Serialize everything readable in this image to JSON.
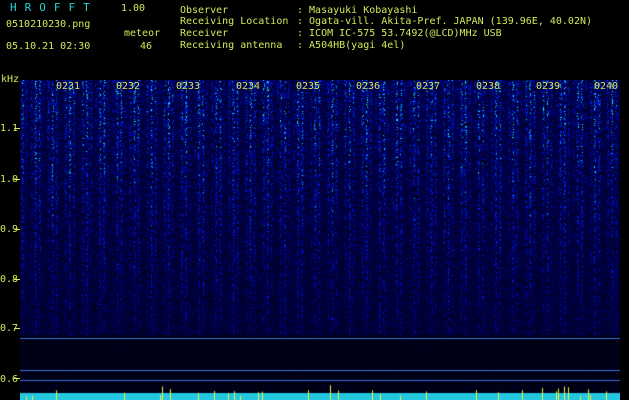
{
  "header": {
    "app_name": "HROFFT",
    "version": "1.00",
    "filename": "0510210230.png",
    "datetime": "05.10.21 02:30",
    "meteor_label": "meteor",
    "meteor_count": "46"
  },
  "info": [
    {
      "key": "Observer",
      "value": ": Masayuki Kobayashi"
    },
    {
      "key": "Receiving Location",
      "value": ": Ogata-vill. Akita-Pref. JAPAN (139.96E, 40.02N)"
    },
    {
      "key": "Receiver",
      "value": ": ICOM IC-575 53.7492(@LCD)MHz USB"
    },
    {
      "key": "Receiving antenna",
      "value": ": A504HB(yagi 4el)"
    }
  ],
  "axis": {
    "unit": "kHz",
    "y_labels": [
      "1.1",
      "1.0",
      "0.9",
      "0.8",
      "0.7",
      "0.6"
    ],
    "x_labels": [
      "0231",
      "0232",
      "0233",
      "0234",
      "0235",
      "0236",
      "0237",
      "0238",
      "0239",
      "0240"
    ]
  }
}
